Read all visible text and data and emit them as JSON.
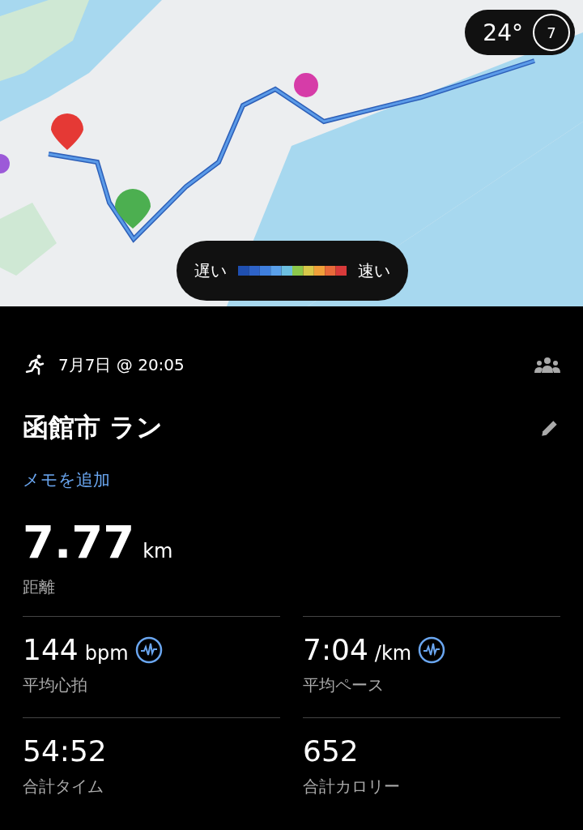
{
  "map": {
    "kind": "picture",
    "weather": {
      "temperature": "24°",
      "wind": "7"
    },
    "legend": {
      "slow": "遅い",
      "fast": "速い"
    }
  },
  "activity": {
    "date": "7月7日 @ 20:05",
    "title": "函館市 ラン",
    "add_note": "メモを追加"
  },
  "distance": {
    "value": "7.77",
    "unit": "km",
    "label": "距離"
  },
  "metrics": [
    {
      "kind": "detail",
      "value": "144",
      "unit": "bpm",
      "label": "平均心拍"
    },
    {
      "kind": "detail",
      "value": "7:04",
      "unit": "/km",
      "label": "平均ペース"
    },
    {
      "kind": "plain",
      "value": "54:52",
      "label": "合計タイム"
    },
    {
      "kind": "plain",
      "value": "652",
      "label": "合計カロリー"
    }
  ]
}
